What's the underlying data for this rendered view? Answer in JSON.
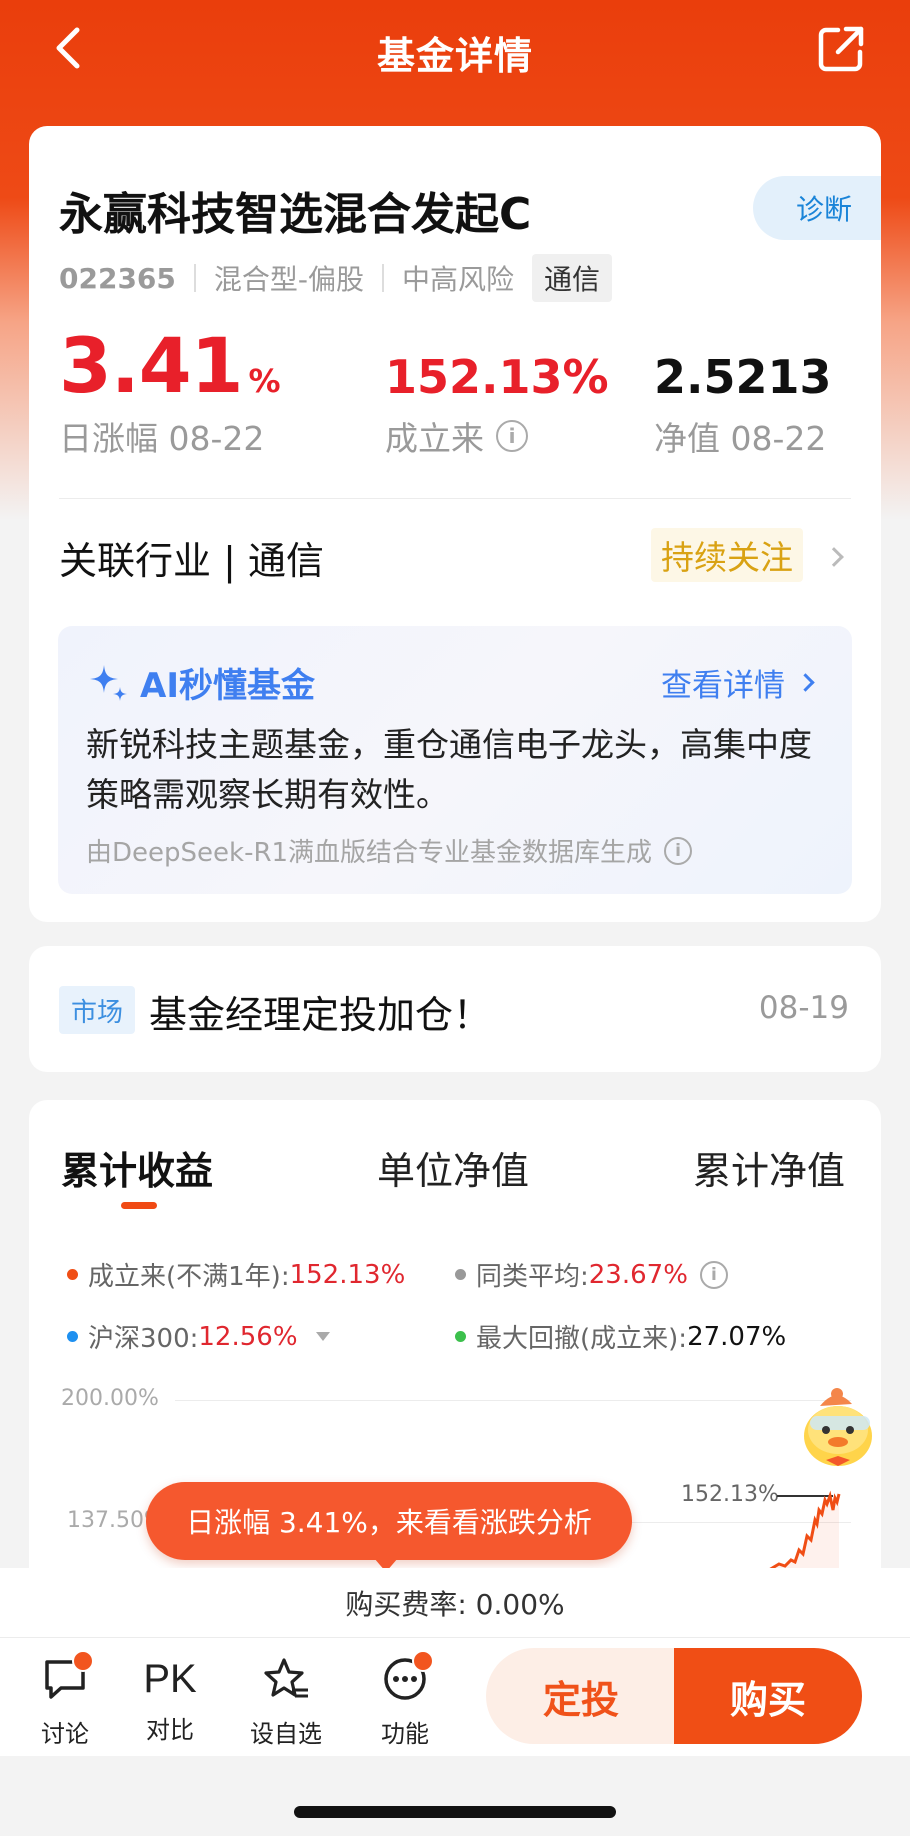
{
  "header": {
    "title": "基金详情",
    "back_icon": "chevron-left-icon",
    "share_icon": "share-icon"
  },
  "fund": {
    "name": "永赢科技智选混合发起C",
    "diagnose_label": "诊断",
    "code": "022365",
    "type": "混合型-偏股",
    "risk": "中高风险",
    "industry_tag": "通信",
    "daily_change_value": "3.41",
    "daily_change_unit": "%",
    "daily_change_label": "日涨幅 08-22",
    "since_inception_value": "152.13%",
    "since_inception_label": "成立来",
    "nav_value": "2.5213",
    "nav_label": "净值 08-22",
    "related_industry": "关联行业 | 通信",
    "follow_label": "持续关注"
  },
  "ai": {
    "title": "AI秒懂基金",
    "more": "查看详情",
    "text": "新锐科技主题基金，重仓通信电子龙头，高集中度策略需观察长期有效性。",
    "source": "由DeepSeek-R1满血版结合专业基金数据库生成"
  },
  "news": {
    "tag": "市场",
    "text": "基金经理定投加仓！",
    "date": "08-19"
  },
  "chart_tabs": [
    "累计收益",
    "单位净值",
    "累计净值"
  ],
  "legend": {
    "l1_label": "成立来(不满1年):",
    "l1_value": "152.13%",
    "l2_label": "同类平均:",
    "l2_value": "23.67%",
    "l3_label": "沪深300:",
    "l3_value": "12.56%",
    "l4_label": "最大回撤(成立来):",
    "l4_value": "27.07%"
  },
  "colors": {
    "fund_line": "#f04e15",
    "category_avg": "#999999",
    "hs300": "#1e90f0",
    "max_drawdown": "#3cc04c"
  },
  "chart_data": {
    "type": "line",
    "y_tick_labels": [
      "200.00%",
      "137.50%"
    ],
    "end_label": "152.13%",
    "series": [
      {
        "name": "成立来(不满1年)",
        "end_value": 152.13
      }
    ]
  },
  "tooltip": "日涨幅 3.41%，来看看涨跌分析",
  "fee": "购买费率:  0.00%",
  "actions": [
    {
      "label": "讨论",
      "icon": "comment-icon"
    },
    {
      "label": "对比",
      "icon": "pk-icon",
      "glyph": "PK"
    },
    {
      "label": "设自选",
      "icon": "star-list-icon"
    },
    {
      "label": "功能",
      "icon": "more-icon"
    }
  ],
  "buttons": {
    "dingtou": "定投",
    "buy": "购买"
  }
}
